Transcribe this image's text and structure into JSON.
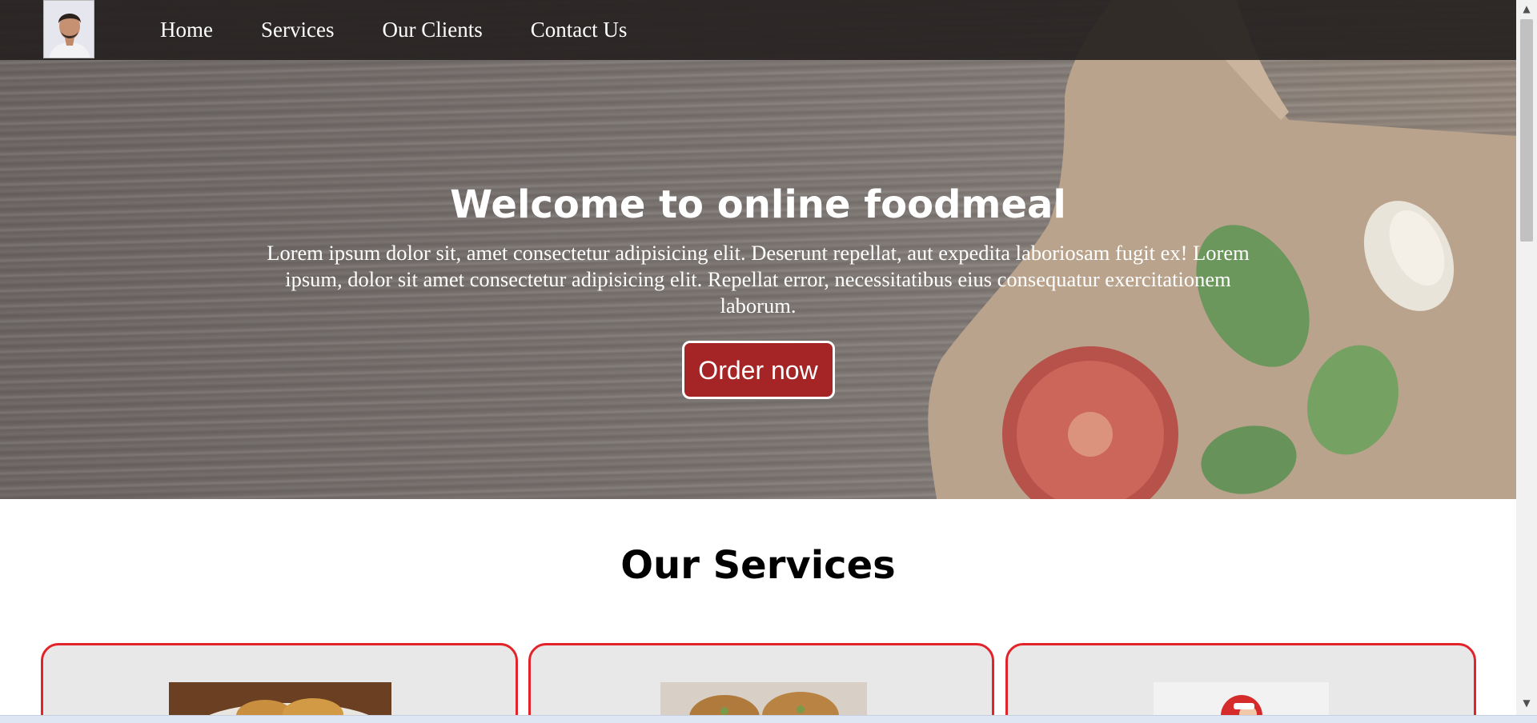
{
  "nav": {
    "links": [
      "Home",
      "Services",
      "Our Clients",
      "Contact Us"
    ]
  },
  "hero": {
    "title": "Welcome to online foodmeal",
    "text": "Lorem ipsum dolor sit, amet consectetur adipisicing elit. Deserunt repellat, aut expedita laboriosam fugit ex! Lorem ipsum, dolor sit amet consectetur adipisicing elit. Repellat error, necessitatibus eius consequatur exercitationem laborum.",
    "button_label": "Order now"
  },
  "services": {
    "title": "Our Services"
  },
  "colors": {
    "accent": "#a52526",
    "card_border": "#e3232a",
    "navbar": "#262221"
  }
}
